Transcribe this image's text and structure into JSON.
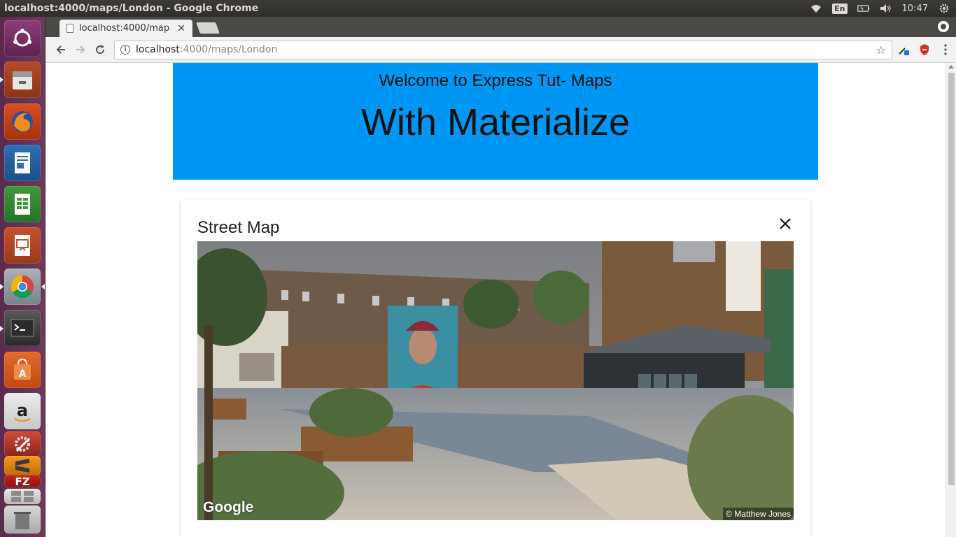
{
  "os": {
    "window_title": "localhost:4000/maps/London - Google Chrome",
    "lang": "En",
    "clock": "10:47",
    "launcher_items": [
      "ubuntu-dash",
      "files",
      "firefox",
      "writer",
      "calc",
      "impress",
      "chrome",
      "terminal",
      "software-center",
      "amazon",
      "settings",
      "sublime",
      "filezilla",
      "workspaces",
      "trash"
    ]
  },
  "browser": {
    "tab_title": "localhost:4000/map",
    "url_host": "localhost",
    "url_path": ":4000/maps/London"
  },
  "page": {
    "hero_subtitle": "Welcome to Express Tut- Maps",
    "hero_title": "With Materialize",
    "hero_color": "#0096f3",
    "card_title": "Street Map",
    "map_logo": "Google",
    "map_credit": "© Matthew Jones"
  }
}
